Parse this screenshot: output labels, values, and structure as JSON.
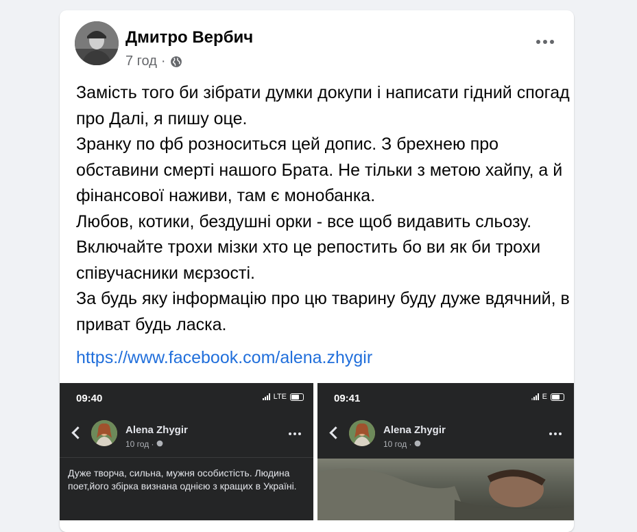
{
  "post": {
    "author": "Дмитро Вербич",
    "time": "7 год",
    "separator": "·",
    "audience_icon": "globe-icon",
    "paragraphs": [
      "Замість того би зібрати думки докупи і написати гідний спогад про Далі, я пишу оце.",
      "Зранку по фб розноситься цей допис. З брехнею про обставини смерті нашого Брата. Не тільки з метою хайпу, а й фінансової наживи, там є монобанка.",
      "Любов, котики, бездушні орки - все щоб видавить сльозу. Включайте трохи мізки хто це репостить бо ви як би трохи співучасники мєрзості.",
      "За будь яку інформацію про цю тварину буду дуже вдячний, в приват будь ласка."
    ],
    "link": "https://www.facebook.com/alena.zhygir"
  },
  "screenshots": [
    {
      "time": "09:40",
      "network": "LTE",
      "name": "Alena Zhygir",
      "meta": "10 год · ",
      "text": "Дуже творча, сильна, мужня особистість. Людина поет,його збірка визнана однією з кращих в Україні."
    },
    {
      "time": "09:41",
      "network": "E",
      "name": "Alena Zhygir",
      "meta": "10 год · "
    }
  ],
  "colors": {
    "background": "#f0f2f5",
    "card": "#ffffff",
    "link": "#216fdb",
    "dark_card": "#242526"
  }
}
